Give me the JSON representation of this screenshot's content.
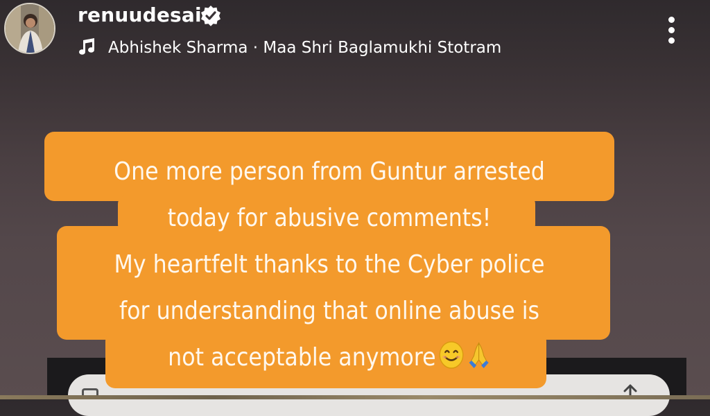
{
  "header": {
    "username": "renuudesai",
    "verified": true,
    "music": {
      "icon": "music-note-icon",
      "artist": "Abhishek Sharma",
      "separator": "·",
      "track": "Maa Shri Baglamukhi Stotram"
    },
    "menu_icon": "more-vertical-icon"
  },
  "story": {
    "background_color": "#f39a2c",
    "text_color": "#fff8ee",
    "lines": [
      "One more person from Guntur arrested",
      "today for abusive comments!",
      "My heartfelt thanks to the Cyber police",
      "for understanding that online abuse is",
      "not acceptable anymore"
    ],
    "emojis": [
      "smiling-face-emoji",
      "folded-hands-emoji"
    ]
  },
  "footer": {
    "reply_icon": "reply-icon",
    "share_icon": "share-icon"
  }
}
